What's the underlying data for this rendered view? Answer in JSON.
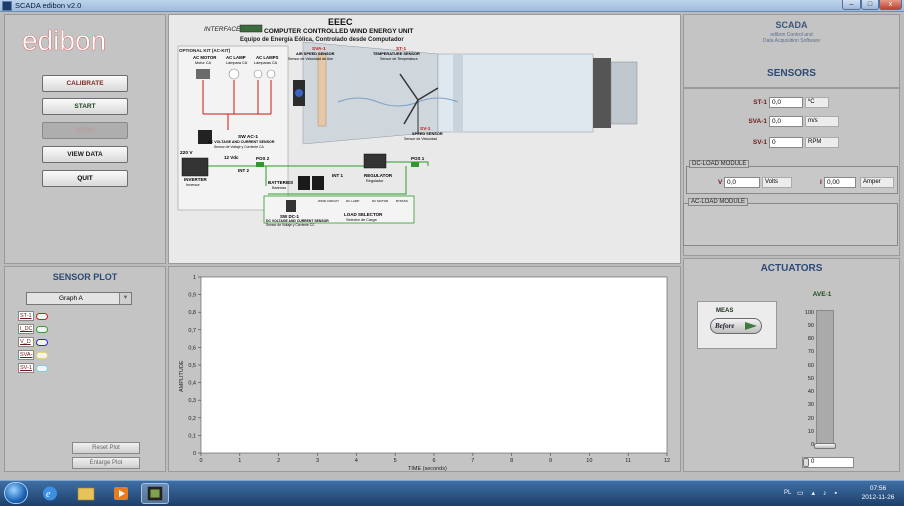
{
  "window": {
    "title": "SCADA edibon v2.0",
    "min_glyph": "–",
    "max_glyph": "□",
    "close_glyph": "x"
  },
  "logo": {
    "text": "edibon",
    "color": "#e1211c"
  },
  "left_controls": {
    "calibrate": "CALIBRATE",
    "start": "START",
    "stop": "STOP",
    "view_data": "VIEW DATA",
    "quit": "QUIT"
  },
  "sensor_plot": {
    "title": "SENSOR PLOT",
    "selected_graph": "Graph A",
    "legend": [
      {
        "label": "ST-1",
        "color": "#d21e1e"
      },
      {
        "label": "I_DC",
        "color": "#2fa12f"
      },
      {
        "label": "V_D",
        "color": "#2a2ad0"
      },
      {
        "label": "SVA-",
        "color": "#e6d47a"
      },
      {
        "label": "SV-1",
        "color": "#7fd0e6"
      }
    ],
    "reset_plot": "Reset Plot",
    "enlarge_plot": "Enlarge Plot"
  },
  "diagram": {
    "interface_label": "INTERFACE",
    "title_code": "EEEC",
    "title": "COMPUTER CONTROLLED WIND ENERGY UNIT",
    "subtitle": "Equipo de Energía Eólica, Controlado desde Computador",
    "optional_kit": "OPTIONAL KIT (AC-KIT)",
    "ac_motor": "AC MOTOR",
    "ac_motor_es": "Motor CA",
    "ac_lamp": "AC LAMP",
    "ac_lamp_es": "Lámpara CA",
    "ac_lamps": "AC LAMPS",
    "ac_lamps_es": "Lámparas CA",
    "sva1": "SVA-1",
    "air_speed_sensor": "AIR SPEED SENSOR",
    "air_speed_sensor_es": "Sensor de Velocidad de Aire",
    "st1": "ST-1",
    "temperature_sensor": "TEMPERATURE SENSOR",
    "temperature_sensor_es": "Sensor de Temperatura",
    "sw_ac1": "SW AC-1",
    "ac_sensor": "AC VOLTAGE AND CURRENT SENSOR",
    "ac_sensor_es": "Sensor de Voltaje y Corriente CA",
    "v220": "220 V",
    "v12": "12 Vdc",
    "inverter": "INVERTER",
    "inverter_es": "Inversor",
    "int2": "INT 2",
    "pos2": "POS 2",
    "sv1": "SV-1",
    "speed_sensor": "SPEED SENSOR",
    "speed_sensor_es": "Sensor de Velocidad",
    "pos1": "POS 1",
    "regulator": "REGULATOR",
    "regulator_es": "Regulador",
    "int1": "INT 1",
    "batteries": "BATTERIES",
    "batteries_es": "Baterías",
    "sw_dc1": "SW DC-1",
    "dc_sensor": "DC VOLTAGE AND CURRENT SENSOR",
    "dc_sensor_es": "Sensor de Voltaje y Corriente CC",
    "load_selector": "LOAD SELECTOR",
    "load_selector_es": "Selector de Carga",
    "load_opt1": "WIND CIRCUIT",
    "load_opt2": "DC LAMP",
    "load_opt3": "DC MOTOR",
    "load_opt4": "BYPASS"
  },
  "chart_data": {
    "type": "line",
    "xlabel": "TIME  (seconds)",
    "ylabel": "AMPLITUDE",
    "xlim": [
      0,
      12
    ],
    "ylim": [
      0,
      1
    ],
    "xticks": [
      "0",
      "1",
      "2",
      "3",
      "4",
      "5",
      "6",
      "7",
      "8",
      "9",
      "10",
      "11",
      "12"
    ],
    "yticks": [
      "0",
      "0,1",
      "0,2",
      "0,3",
      "0,4",
      "0,5",
      "0,6",
      "0,7",
      "0,8",
      "0,9",
      "1"
    ],
    "series": []
  },
  "scada_header": {
    "title": "SCADA",
    "sub1": "edibon Control and",
    "sub2": "Data Acquisition Software"
  },
  "sensors": {
    "title": "SENSORS",
    "rows": [
      {
        "name": "ST-1",
        "value": "0,0",
        "unit": "ºC"
      },
      {
        "name": "SVA-1",
        "value": "0,0",
        "unit": "m/s"
      },
      {
        "name": "SV-1",
        "value": "0",
        "unit": "RPM"
      }
    ],
    "dc_module": {
      "label": "DC-LOAD MODULE",
      "v_name": "V",
      "v_value": "0,0",
      "v_unit": "Volts",
      "i_name": "I",
      "i_value": "0,00",
      "i_unit": "Amper"
    },
    "ac_module": {
      "label": "AC-LOAD MODULE"
    }
  },
  "actuators": {
    "title": "ACTUATORS",
    "meas_label": "MEAS",
    "before_button": "Before",
    "ave_title": "AVE-1",
    "ave_value": "0",
    "ave_ticks": [
      "100",
      "90",
      "80",
      "70",
      "60",
      "50",
      "40",
      "30",
      "20",
      "10",
      "0"
    ]
  },
  "taskbar": {
    "lang": "PL",
    "time": "07:56",
    "date": "2012-11-26"
  }
}
